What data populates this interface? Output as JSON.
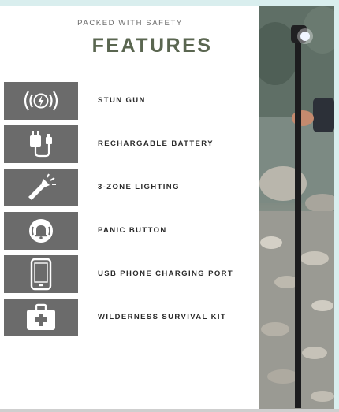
{
  "header": {
    "kicker": "PACKED WITH SAFETY",
    "title": "FEATURES"
  },
  "features": [
    {
      "label": "STUN GUN",
      "icon": "stun-gun-icon"
    },
    {
      "label": "RECHARGABLE BATTERY",
      "icon": "charger-icon"
    },
    {
      "label": "3-ZONE LIGHTING",
      "icon": "flashlight-icon"
    },
    {
      "label": "PANIC BUTTON",
      "icon": "alarm-bell-icon"
    },
    {
      "label": "USB PHONE CHARGING PORT",
      "icon": "phone-icon"
    },
    {
      "label": "WILDERNESS SURVIVAL KIT",
      "icon": "first-aid-kit-icon"
    }
  ],
  "colors": {
    "title": "#5a6650",
    "icon_box": "#6b6b6b",
    "page_frame": "#d9eeee"
  }
}
